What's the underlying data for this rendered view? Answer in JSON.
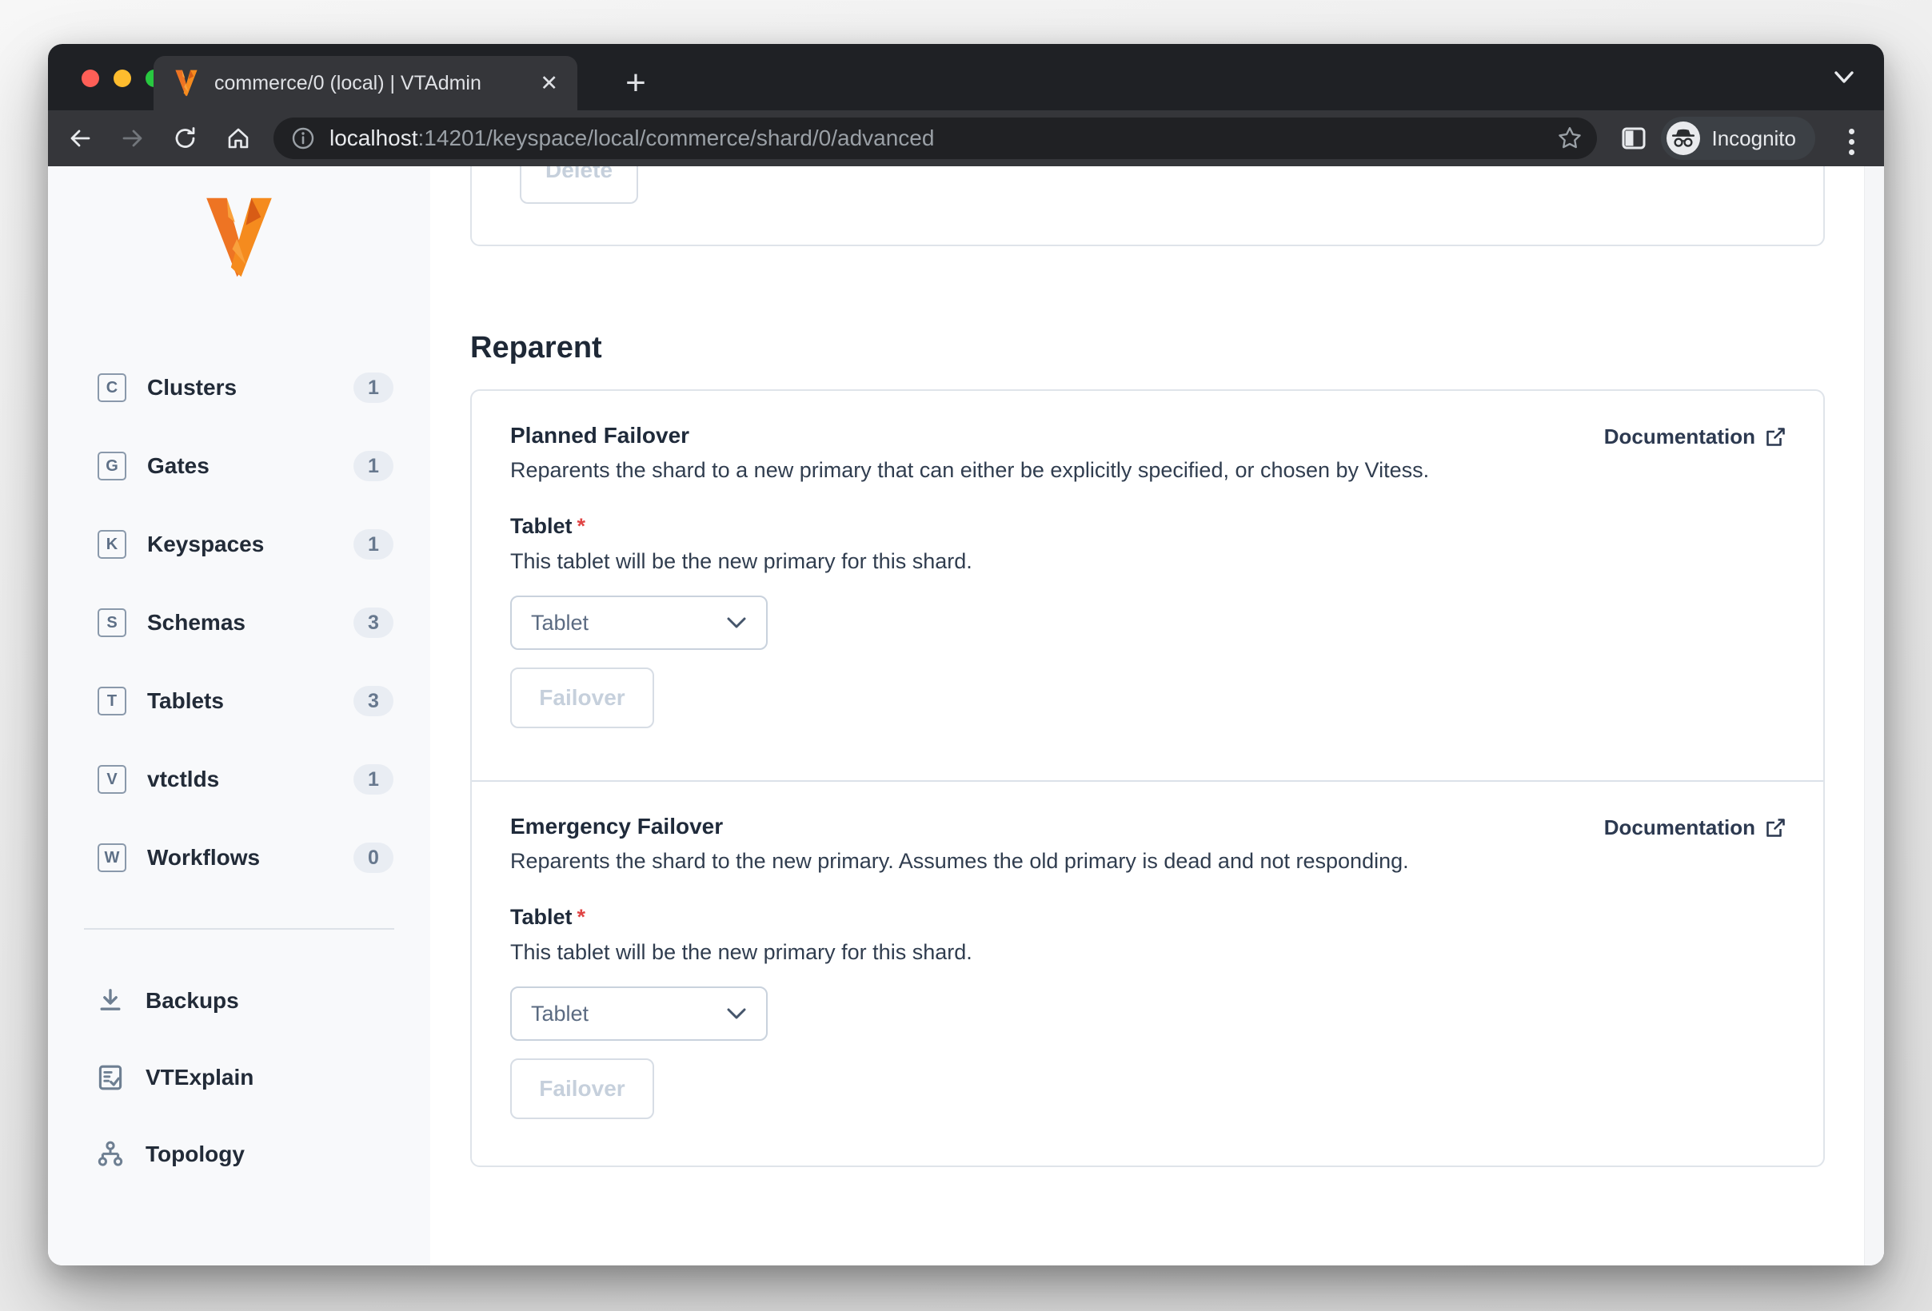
{
  "browser": {
    "tab_title": "commerce/0 (local) | VTAdmin",
    "tab_close_glyph": "✕",
    "new_tab_glyph": "+",
    "url_host": "localhost",
    "url_path": ":14201/keyspace/local/commerce/shard/0/advanced",
    "incognito_label": "Incognito"
  },
  "sidebar": {
    "nav": [
      {
        "letter": "C",
        "label": "Clusters",
        "count": "1"
      },
      {
        "letter": "G",
        "label": "Gates",
        "count": "1"
      },
      {
        "letter": "K",
        "label": "Keyspaces",
        "count": "1"
      },
      {
        "letter": "S",
        "label": "Schemas",
        "count": "3"
      },
      {
        "letter": "T",
        "label": "Tablets",
        "count": "3"
      },
      {
        "letter": "V",
        "label": "vtctlds",
        "count": "1"
      },
      {
        "letter": "W",
        "label": "Workflows",
        "count": "0"
      }
    ],
    "tools": [
      {
        "icon": "backups-icon",
        "label": "Backups"
      },
      {
        "icon": "vtexplain-icon",
        "label": "VTExplain"
      },
      {
        "icon": "topology-icon",
        "label": "Topology"
      }
    ]
  },
  "main": {
    "delete_label": "Delete",
    "section_title": "Reparent",
    "panels": [
      {
        "heading": "Planned Failover",
        "doc_label": "Documentation",
        "description": "Reparents the shard to a new primary that can either be explicitly specified, or chosen by Vitess.",
        "field_label": "Tablet",
        "required_mark": "*",
        "field_help": "This tablet will be the new primary for this shard.",
        "select_value": "Tablet",
        "action_label": "Failover"
      },
      {
        "heading": "Emergency Failover",
        "doc_label": "Documentation",
        "description": "Reparents the shard to the new primary. Assumes the old primary is dead and not responding.",
        "field_label": "Tablet",
        "required_mark": "*",
        "field_help": "This tablet will be the new primary for this shard.",
        "select_value": "Tablet",
        "action_label": "Failover"
      }
    ]
  },
  "colors": {
    "brand_orange": "#f26b21",
    "required_red": "#e04545",
    "disabled_text": "#c6d0dc",
    "badge_bg": "#e9edf3",
    "badge_text": "#67788e"
  }
}
